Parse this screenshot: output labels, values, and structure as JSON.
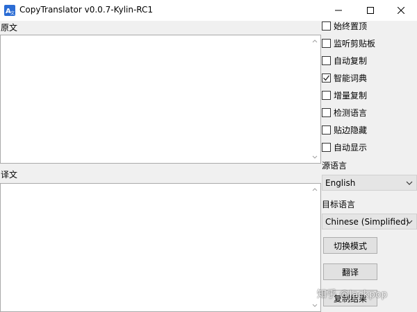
{
  "window": {
    "title": "CopyTranslator v0.0.7-Kylin-RC1",
    "icon": "translate-app-icon"
  },
  "source": {
    "label": "原文",
    "text": ""
  },
  "target": {
    "label": "译文",
    "text": ""
  },
  "options": [
    {
      "label": "始终置顶",
      "checked": false
    },
    {
      "label": "监听剪贴板",
      "checked": false
    },
    {
      "label": "自动复制",
      "checked": false
    },
    {
      "label": "智能词典",
      "checked": true
    },
    {
      "label": "增量复制",
      "checked": false
    },
    {
      "label": "检测语言",
      "checked": false
    },
    {
      "label": "贴边隐藏",
      "checked": false
    },
    {
      "label": "自动显示",
      "checked": false
    }
  ],
  "source_language": {
    "label": "源语言",
    "selected": "English"
  },
  "target_language": {
    "label": "目标语言",
    "selected": "Chinese (Simplified)"
  },
  "buttons": {
    "switch_mode": "切换模式",
    "translate": "翻译",
    "copy_result": "复制结果"
  },
  "watermark": "知乎 @Jackpop",
  "colors": {
    "background": "#f0f0f0",
    "titlebar": "#ffffff",
    "select_bg": "#e5e5e5",
    "button_bg": "#e1e1e1"
  }
}
